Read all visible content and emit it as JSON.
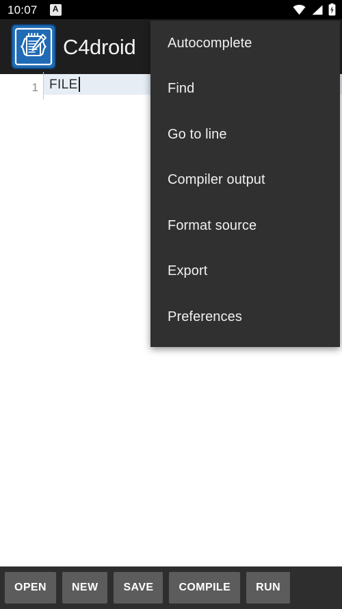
{
  "status_bar": {
    "clock": "10:07",
    "notification_icon_letter": "A",
    "icons": [
      "wifi-icon",
      "cell-signal-icon",
      "battery-charging-icon"
    ]
  },
  "app_bar": {
    "title": "C4droid",
    "logo_icon": "c4droid-notepad-pencil-logo",
    "logo_color": "#1f6bb5"
  },
  "editor": {
    "line_number": "1",
    "code": "FILE",
    "current_line_highlight_color": "#e6edf5",
    "background_color": "#ffffff"
  },
  "menu": {
    "background_color": "#303030",
    "items": [
      {
        "label": "Autocomplete"
      },
      {
        "label": "Find"
      },
      {
        "label": "Go to line"
      },
      {
        "label": "Compiler output"
      },
      {
        "label": "Format source"
      },
      {
        "label": "Export"
      },
      {
        "label": "Preferences"
      }
    ]
  },
  "bottom_bar": {
    "background_color": "#2e2e2e",
    "button_color": "#5c5c5c",
    "buttons": [
      {
        "label": "OPEN"
      },
      {
        "label": "NEW"
      },
      {
        "label": "SAVE"
      },
      {
        "label": "COMPILE"
      },
      {
        "label": "RUN"
      }
    ]
  }
}
